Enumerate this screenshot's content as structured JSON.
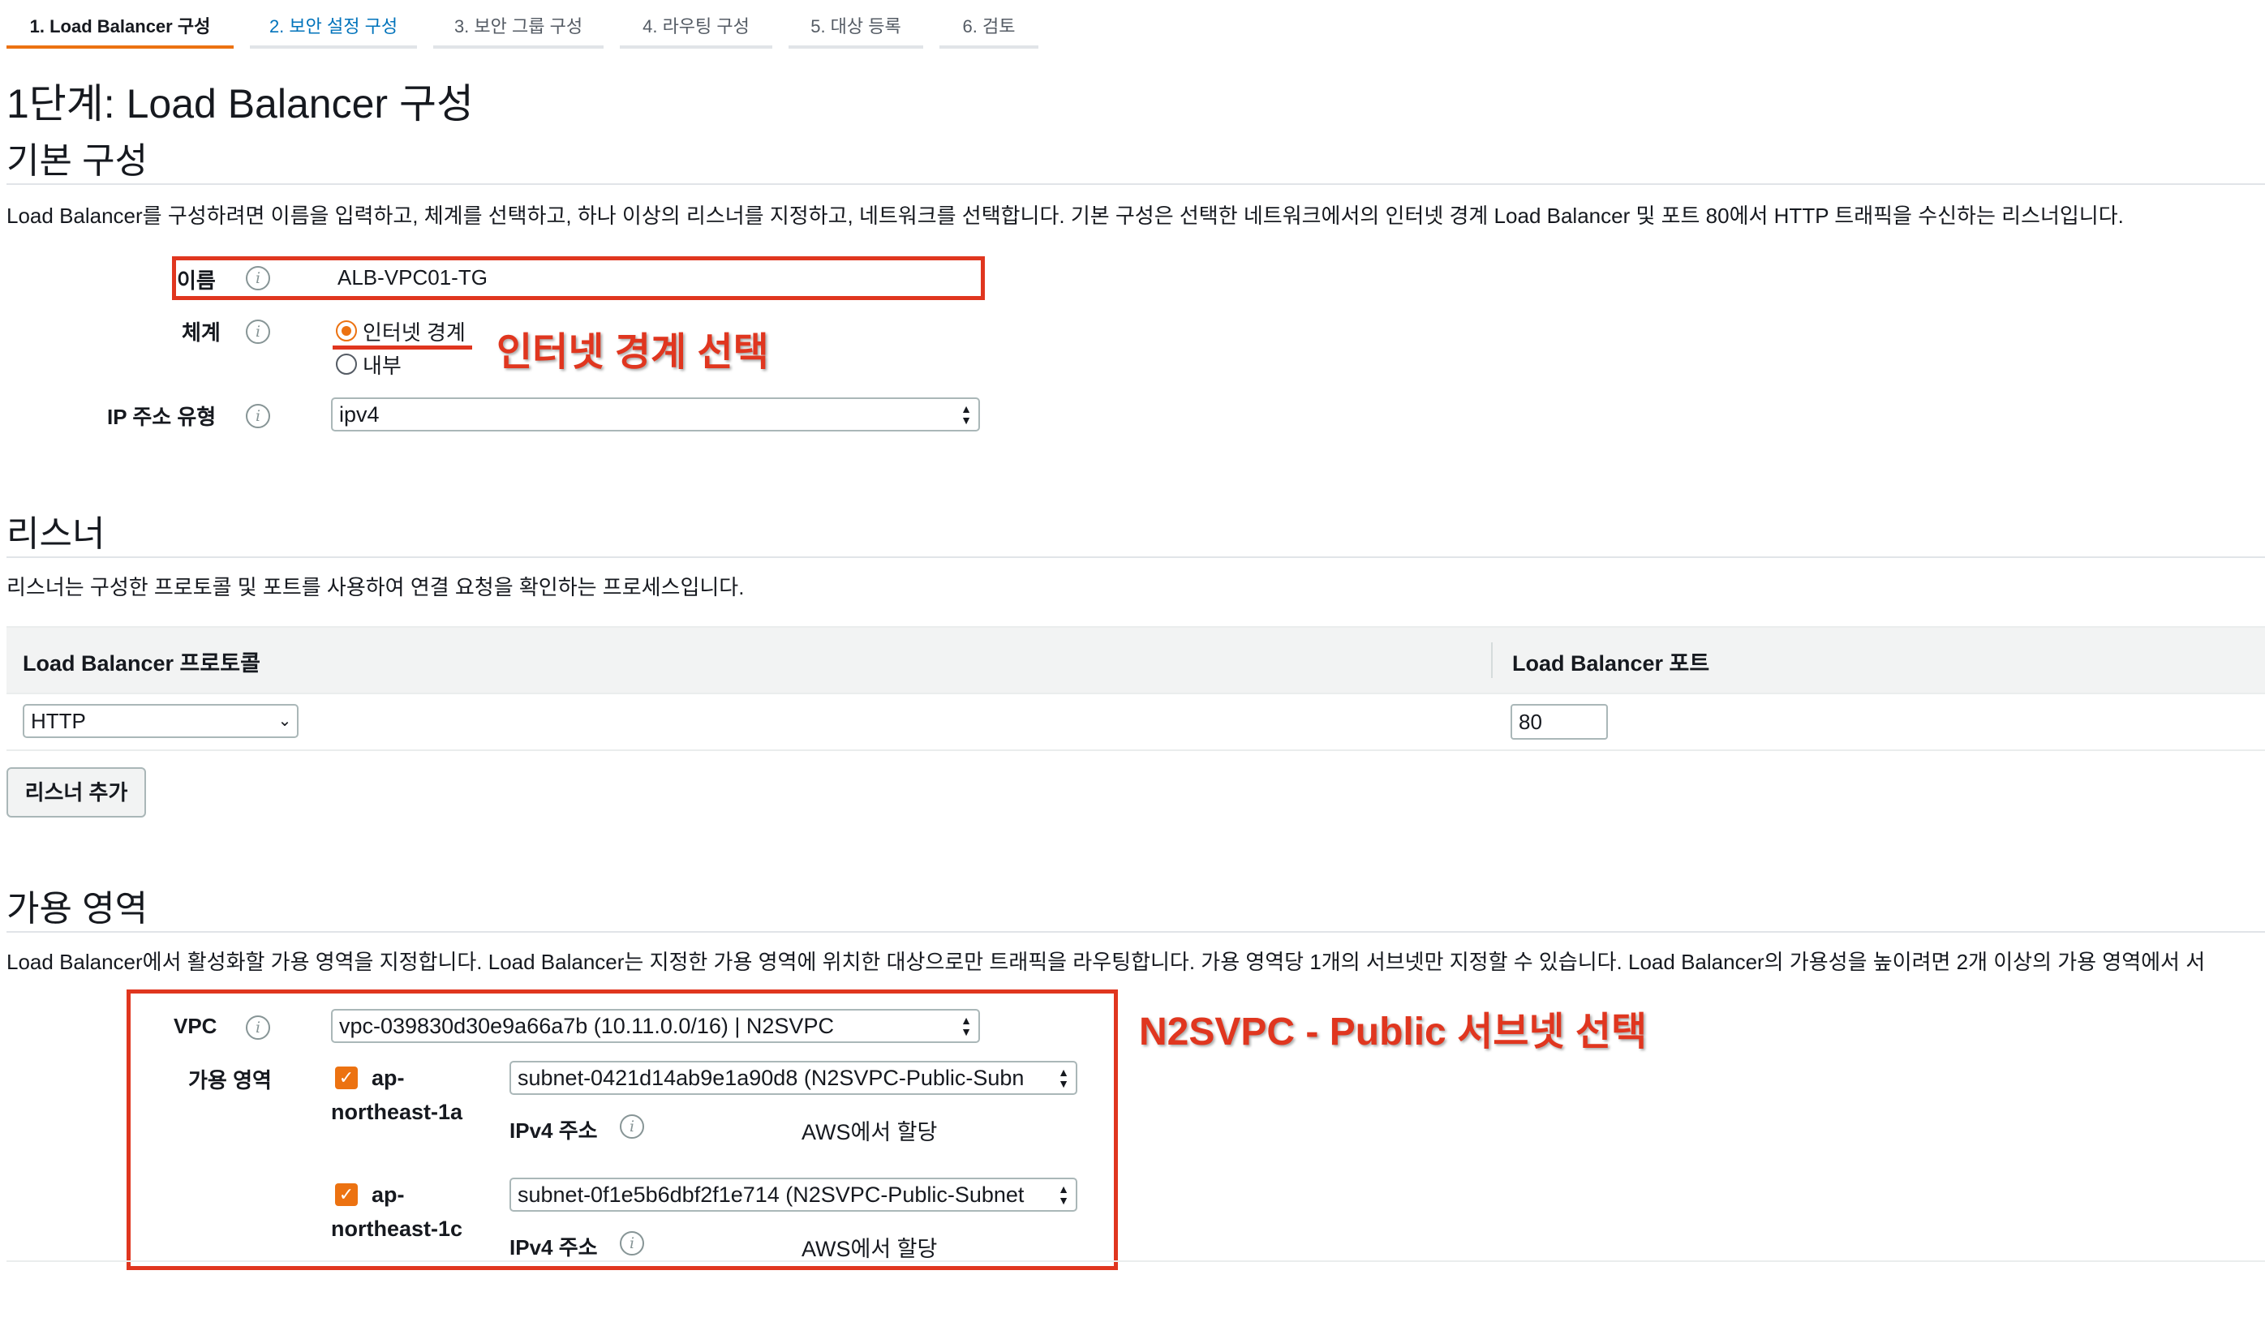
{
  "tabs": [
    {
      "label": "1. Load Balancer 구성"
    },
    {
      "label": "2. 보안 설정 구성"
    },
    {
      "label": "3. 보안 그룹 구성"
    },
    {
      "label": "4. 라우팅 구성"
    },
    {
      "label": "5. 대상 등록"
    },
    {
      "label": "6. 검토"
    }
  ],
  "page_title": "1단계: Load Balancer 구성",
  "basic": {
    "title": "기본 구성",
    "description": "Load Balancer를 구성하려면 이름을 입력하고, 체계를 선택하고, 하나 이상의 리스너를 지정하고, 네트워크를 선택합니다. 기본 구성은 선택한 네트워크에서의 인터넷 경계 Load Balancer 및 포트 80에서 HTTP 트래픽을 수신하는 리스너입니다.",
    "name_label": "이름",
    "name_value": "ALB-VPC01-TG",
    "scheme_label": "체계",
    "scheme_options": [
      "인터넷 경계",
      "내부"
    ],
    "scheme_selected": "인터넷 경계",
    "ip_type_label": "IP 주소 유형",
    "ip_type_value": "ipv4"
  },
  "listeners": {
    "title": "리스너",
    "description": "리스너는 구성한 프로토콜 및 포트를 사용하여 연결 요청을 확인하는 프로세스입니다.",
    "col_protocol": "Load Balancer 프로토콜",
    "col_port": "Load Balancer 포트",
    "protocol_value": "HTTP",
    "port_value": "80",
    "add_button": "리스너 추가"
  },
  "az": {
    "title": "가용 영역",
    "description": "Load Balancer에서 활성화할 가용 영역을 지정합니다. Load Balancer는 지정한 가용 영역에 위치한 대상으로만 트래픽을 라우팅합니다. 가용 영역당 1개의 서브넷만 지정할 수 있습니다. Load Balancer의 가용성을 높이려면 2개 이상의 가용 영역에서 서",
    "vpc_label": "VPC",
    "vpc_value": "vpc-039830d30e9a66a7b (10.11.0.0/16) | N2SVPC",
    "zones_label": "가용 영역",
    "zones": [
      {
        "name_line1": "ap-",
        "name_line2": "northeast-1a",
        "subnet": "subnet-0421d14ab9e1a90d8 (N2SVPC-Public-Subn",
        "ipv4_label": "IPv4 주소",
        "ipv4_value": "AWS에서 할당"
      },
      {
        "name_line1": "ap-",
        "name_line2": "northeast-1c",
        "subnet": "subnet-0f1e5b6dbf2f1e714 (N2SVPC-Public-Subnet",
        "ipv4_label": "IPv4 주소",
        "ipv4_value": "AWS에서 할당"
      }
    ]
  },
  "annotations": {
    "scheme_note": "인터넷 경계 선택",
    "vpc_note": "N2SVPC - Public 서브넷 선택"
  },
  "colors": {
    "accent": "#ec7211",
    "annotation": "#e0361f",
    "link": "#0073bb"
  }
}
